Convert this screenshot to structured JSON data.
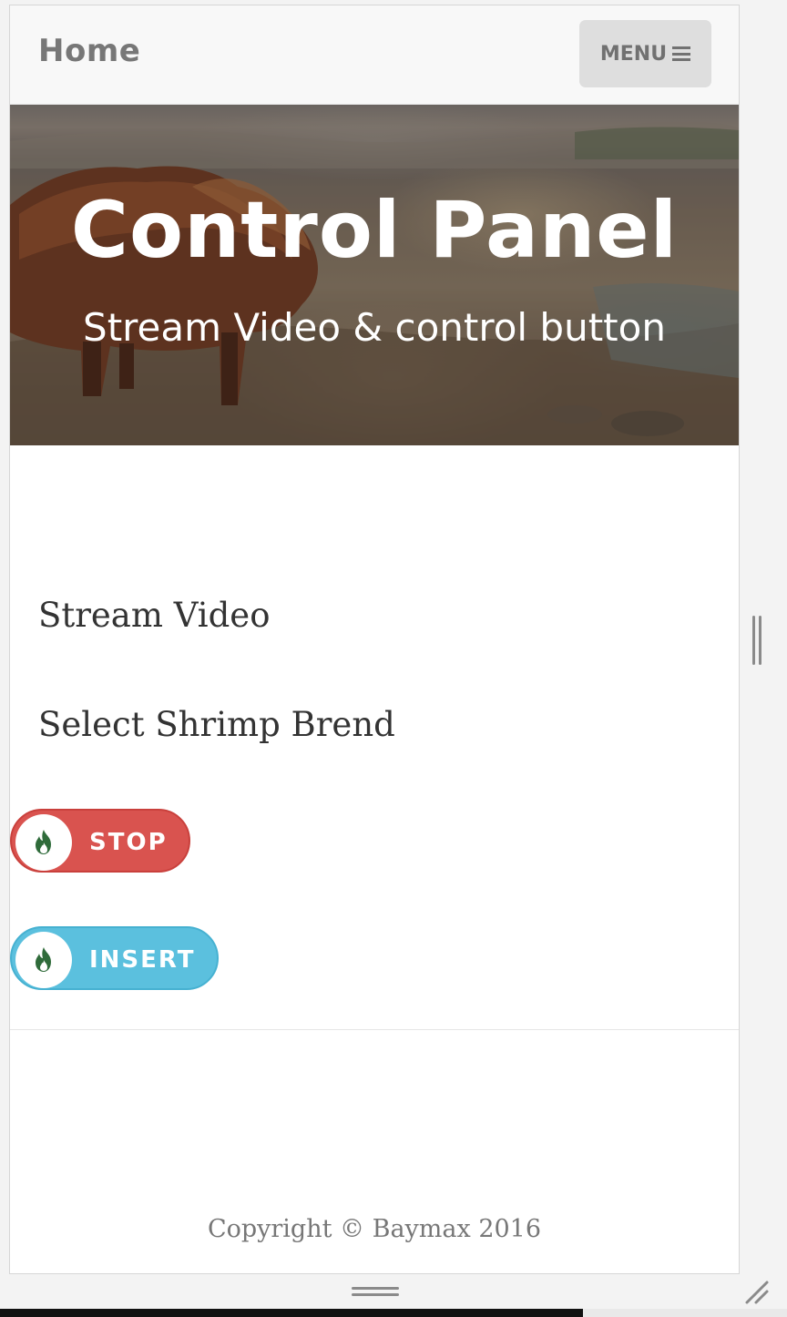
{
  "navbar": {
    "brand": "Home",
    "menu_label": "MENU",
    "menu_icon": "hamburger-icon"
  },
  "hero": {
    "title": "Control Panel",
    "subtitle": "Stream Video & control button",
    "background": "highland-cow-photo"
  },
  "content": {
    "stream_video": "Stream Video",
    "select_label": "Select Shrimp Brend",
    "buttons": [
      {
        "label": "STOP",
        "icon": "flame-icon",
        "color": "#d9534f"
      },
      {
        "label": "INSERT",
        "icon": "flame-icon",
        "color": "#5bc0de"
      }
    ]
  },
  "footer": {
    "copyright": "Copyright © Baymax 2016"
  },
  "colors": {
    "navbar_bg": "#f8f8f8",
    "menu_bg": "#dedede",
    "stop": "#d9534f",
    "insert": "#5bc0de",
    "flame": "#2f6b3a"
  }
}
